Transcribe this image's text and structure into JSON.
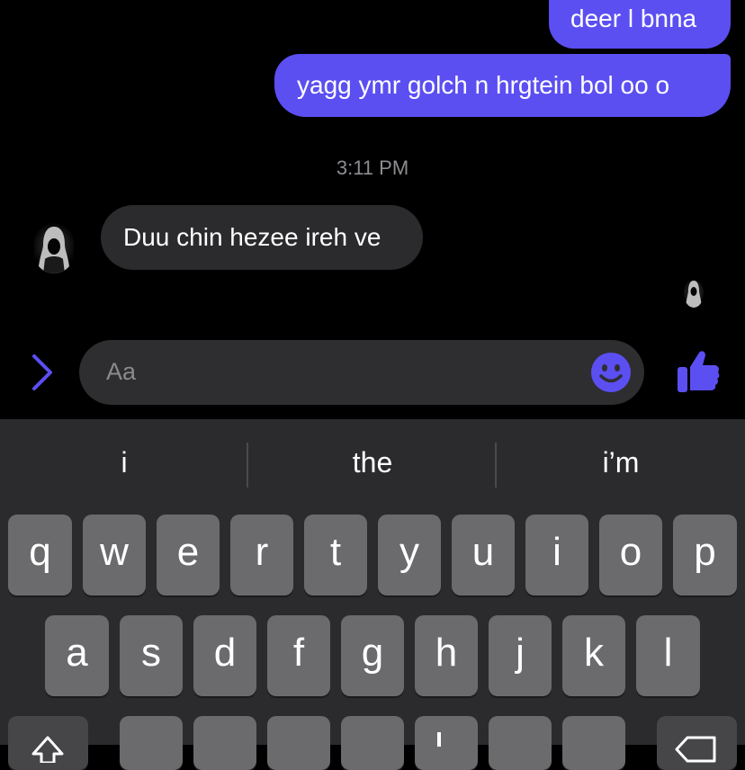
{
  "messages": {
    "outgoing_1": "deer l bnna",
    "outgoing_2": "yagg ymr golch n hrgtein bol oo o",
    "timestamp": "3:11 PM",
    "incoming_1": "Duu chin hezee ireh ve"
  },
  "composer": {
    "placeholder": "Aa",
    "expand_icon": "chevron-right-icon",
    "emoji_icon": "smiley-icon",
    "like_icon": "thumbs-up-icon"
  },
  "keyboard": {
    "suggestions": [
      "i",
      "the",
      "i’m"
    ],
    "row1": [
      "q",
      "w",
      "e",
      "r",
      "t",
      "y",
      "u",
      "i",
      "o",
      "p"
    ],
    "row2": [
      "a",
      "s",
      "d",
      "f",
      "g",
      "h",
      "j",
      "k",
      "l"
    ]
  },
  "colors": {
    "accent": "#5b4ff2",
    "background": "#000000",
    "incoming_bubble": "#2b2b2d",
    "keyboard_bg": "#2b2b2d",
    "key_bg": "#6b6b6d"
  }
}
